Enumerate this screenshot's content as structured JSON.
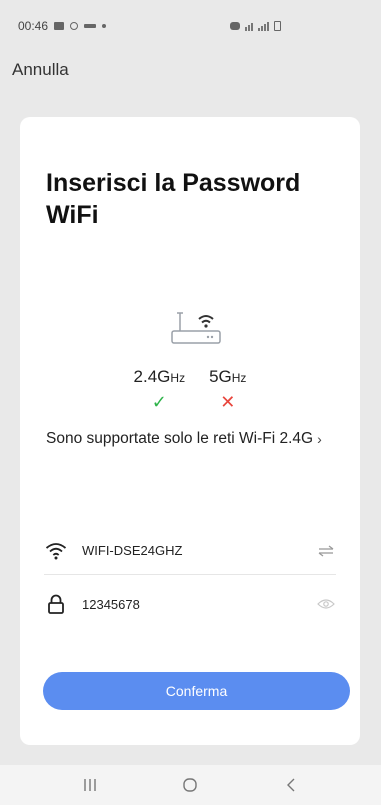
{
  "status_bar": {
    "time": "00:46",
    "left_icons": [
      "image-icon",
      "location-icon",
      "voicemail-icon",
      "dot-icon"
    ],
    "right_icons": [
      "alarm-icon",
      "wifi-signal-icon",
      "cell-signal-icon",
      "battery-icon"
    ]
  },
  "header": {
    "cancel_label": "Annulla"
  },
  "card": {
    "title": "Inserisci la Password WiFi",
    "router_icon": "router-wifi-icon",
    "bands": [
      {
        "label": "2.4G",
        "unit": "Hz",
        "supported": true,
        "mark": "✓",
        "color": "#2eb34a"
      },
      {
        "label": "5G",
        "unit": "Hz",
        "supported": false,
        "mark": "✕",
        "color": "#e8453c"
      }
    ],
    "notice": "Sono supportate solo le reti Wi-Fi 2.4G",
    "notice_chevron": "›",
    "ssid_field": {
      "icon": "wifi-icon",
      "value": "WIFI-DSE24GHZ",
      "action_icon": "switch-network-icon"
    },
    "password_field": {
      "icon": "lock-icon",
      "value": "12345678",
      "action_icon": "eye-icon"
    },
    "confirm_label": "Conferma",
    "accent_color": "#5b8df0"
  },
  "nav_bar": {
    "recent_icon": "recent-apps-icon",
    "home_icon": "home-icon",
    "back_icon": "back-icon"
  }
}
